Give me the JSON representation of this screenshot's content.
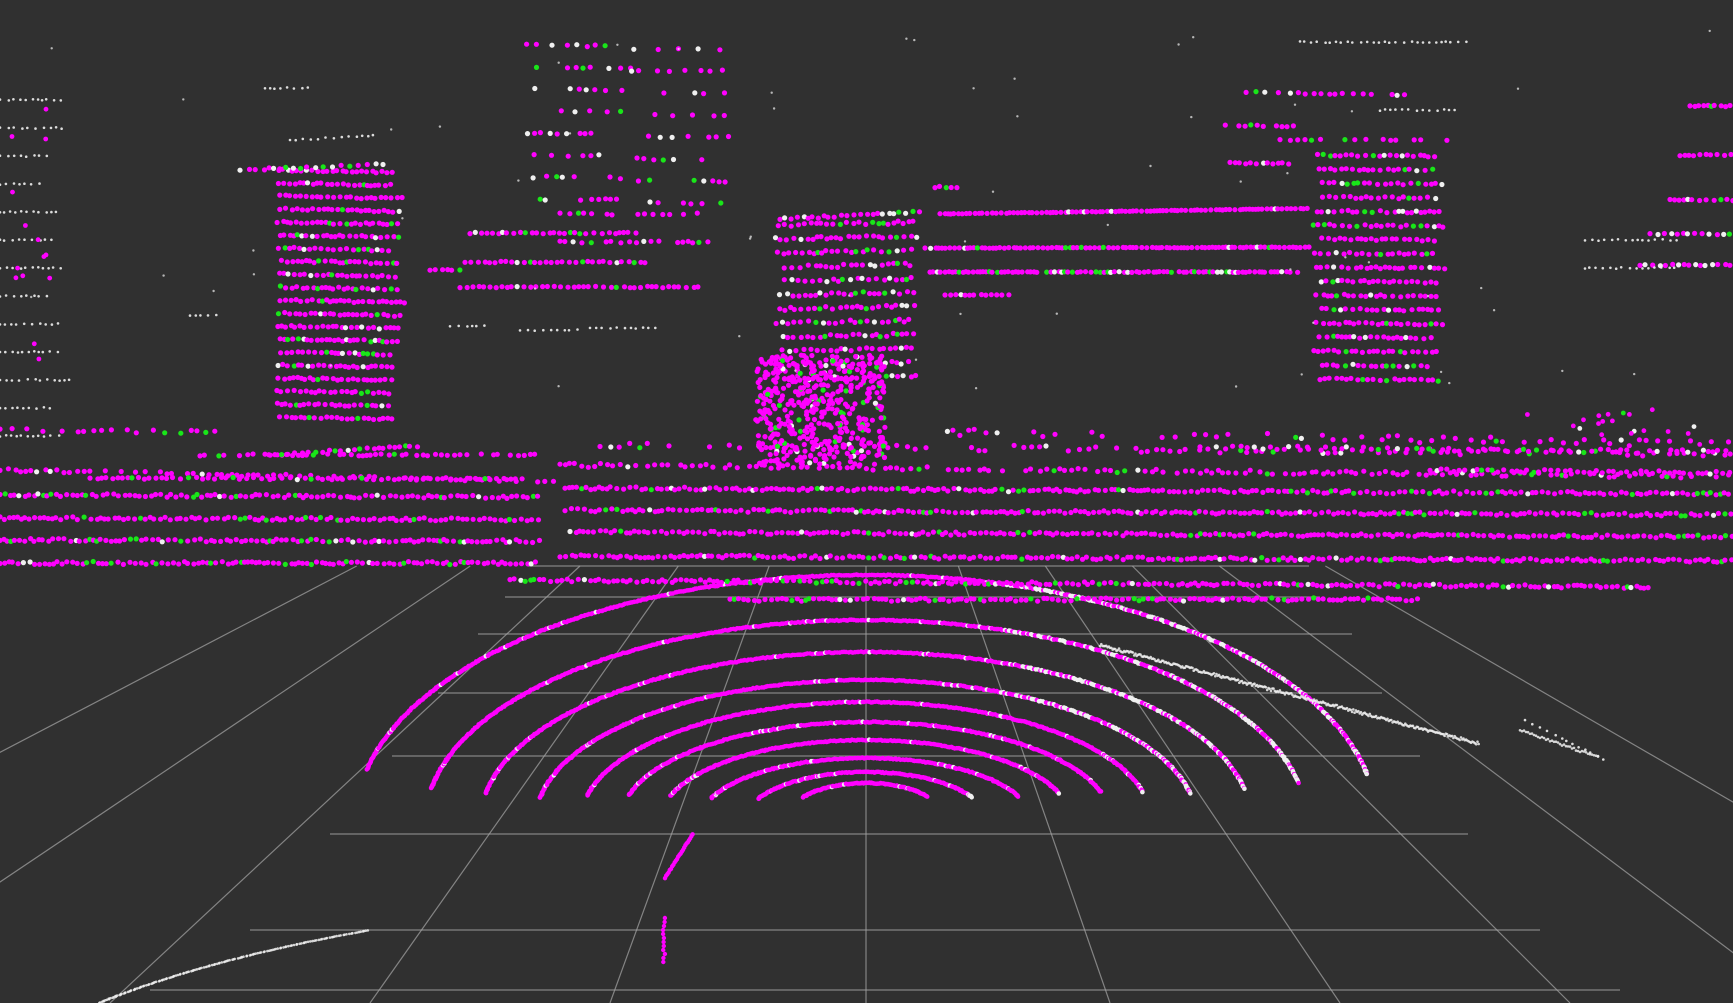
{
  "viewer": {
    "background_color": "#303030",
    "grid_color": "#a0a0a0",
    "point_colors": {
      "intensity_high": "#ff00ff",
      "intensity_mid": "#19e619",
      "unclassified": "#f0f0f0"
    },
    "icon": "point-cloud-view"
  }
}
